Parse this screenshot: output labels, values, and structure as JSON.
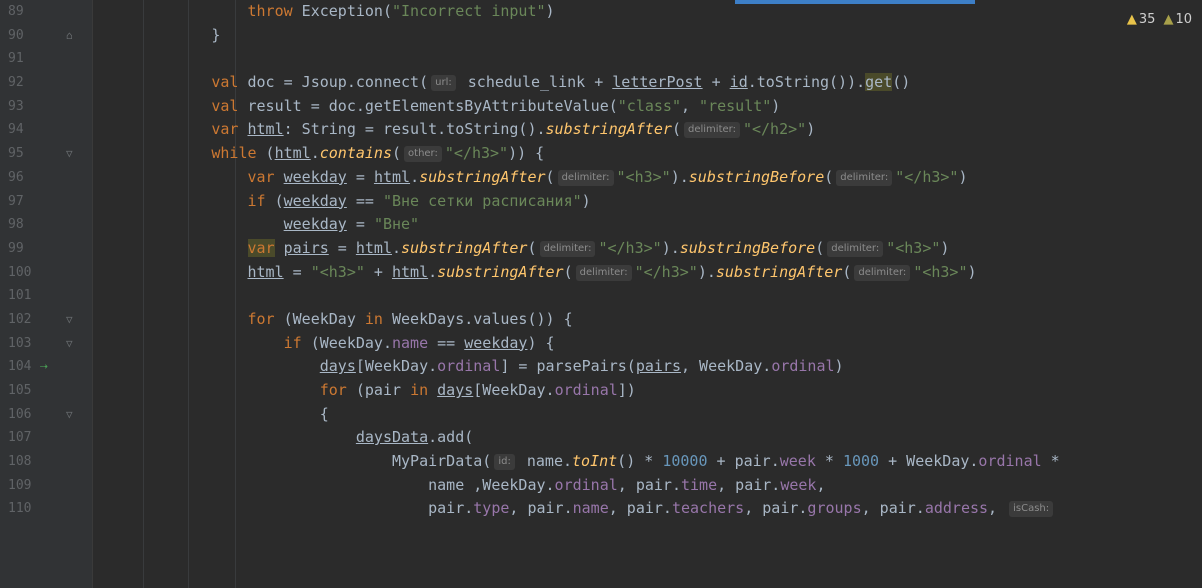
{
  "inspections": {
    "warnings": "35",
    "weak_warnings": "10"
  },
  "line_numbers": [
    "89",
    "90",
    "91",
    "92",
    "93",
    "94",
    "95",
    "96",
    "97",
    "98",
    "99",
    "100",
    "101",
    "102",
    "103",
    "104",
    "105",
    "106",
    "107",
    "108",
    "109",
    "110"
  ],
  "code": {
    "l89": {
      "indent": "                ",
      "kw": "throw",
      "p1": " Exception(",
      "s1": "\"Incorrect input\"",
      "p2": ")"
    },
    "l90": {
      "text": "            }"
    },
    "l92": {
      "indent": "            ",
      "kw": "val",
      "p1": " doc = Jsoup.connect(",
      "h1": "url:",
      "p2": " schedule_link + ",
      "u1": "letterPost",
      "p3": " + ",
      "u2": "id",
      "p4": ".toString()).",
      "m1": "get",
      "p5": "()"
    },
    "l93": {
      "indent": "            ",
      "kw": "val",
      "p1": " result = doc.getElementsByAttributeValue(",
      "s1": "\"class\"",
      "p2": ", ",
      "s2": "\"result\"",
      "p3": ")"
    },
    "l94": {
      "indent": "            ",
      "kw": "var",
      "sp": " ",
      "u1": "html",
      "p1": ": String = result.toString().",
      "f1": "substringAfter",
      "p2": "(",
      "h1": "delimiter:",
      "s1": "\"</h2>\"",
      "p3": ")"
    },
    "l95": {
      "indent": "            ",
      "kw": "while",
      "p1": " (",
      "u1": "html",
      "p2": ".",
      "f1": "contains",
      "p3": "(",
      "h1": "other:",
      "s1": "\"</h3>\"",
      "p4": ")) {"
    },
    "l96": {
      "indent": "                ",
      "kw": "var",
      "sp": " ",
      "u1": "weekday",
      "p1": " = ",
      "u2": "html",
      "p2": ".",
      "f1": "substringAfter",
      "p3": "(",
      "h1": "delimiter:",
      "s1": "\"<h3>\"",
      "p4": ").",
      "f2": "substringBefore",
      "p5": "(",
      "h2": "delimiter:",
      "s2": "\"</h3>\"",
      "p6": ")"
    },
    "l97": {
      "indent": "                ",
      "kw": "if",
      "p1": " (",
      "u1": "weekday",
      "p2": " == ",
      "s1": "\"Вне сетки расписания\"",
      "p3": ")"
    },
    "l98": {
      "indent": "                    ",
      "u1": "weekday",
      "p1": " = ",
      "s1": "\"Вне\""
    },
    "l99": {
      "indent": "                ",
      "kw": "var",
      "sp": " ",
      "u1": "pairs",
      "p1": " = ",
      "u2": "html",
      "p2": ".",
      "f1": "substringAfter",
      "p3": "(",
      "h1": "delimiter:",
      "s1": "\"</h3>\"",
      "p4": ").",
      "f2": "substringBefore",
      "p5": "(",
      "h2": "delimiter:",
      "s2": "\"<h3>\"",
      "p6": ")"
    },
    "l100": {
      "indent": "                ",
      "u1": "html",
      "p1": " = ",
      "s1": "\"<h3>\"",
      "p2": " + ",
      "u2": "html",
      "p3": ".",
      "f1": "substringAfter",
      "p4": "(",
      "h1": "delimiter:",
      "s2": "\"</h3>\"",
      "p5": ").",
      "f2": "substringAfter",
      "p6": "(",
      "h2": "delimiter:",
      "s3": "\"<h3>\"",
      "p7": ")"
    },
    "l102": {
      "indent": "                ",
      "kw": "for",
      "p1": " (WeekDay ",
      "kw2": "in",
      "p2": " WeekDays.values()) {"
    },
    "l103": {
      "indent": "                    ",
      "kw": "if",
      "p1": " (WeekDay.",
      "fd1": "name",
      "p2": " == ",
      "u1": "weekday",
      "p3": ") {"
    },
    "l104": {
      "indent": "                        ",
      "u1": "days",
      "p1": "[WeekDay.",
      "fd1": "ordinal",
      "p2": "] = parsePairs(",
      "u2": "pairs",
      "p3": ", WeekDay.",
      "fd2": "ordinal",
      "p4": ")"
    },
    "l105": {
      "indent": "                        ",
      "kw": "for",
      "p1": " (pair ",
      "kw2": "in",
      "sp": " ",
      "u1": "days",
      "p2": "[WeekDay.",
      "fd1": "ordinal",
      "p3": "])"
    },
    "l106": {
      "text": "                        {"
    },
    "l107": {
      "indent": "                            ",
      "u1": "daysData",
      "p1": ".add("
    },
    "l108": {
      "indent": "                                ",
      "p1": "MyPairData(",
      "h1": "id:",
      "p2": " name.",
      "f1": "toInt",
      "p3": "() * ",
      "n1": "10000",
      "p4": " + pair.",
      "fd1": "week",
      "p5": " * ",
      "n2": "1000",
      "p6": " + WeekDay.",
      "fd2": "ordinal",
      "p7": " *"
    },
    "l109": {
      "indent": "                                    ",
      "p1": "name ,WeekDay.",
      "fd1": "ordinal",
      "p2": ", pair.",
      "fd2": "time",
      "p3": ", pair.",
      "fd3": "week",
      "p4": ","
    },
    "l110": {
      "indent": "                                    ",
      "p1": "pair.",
      "fd1": "type",
      "p2": ", pair.",
      "fd2": "name",
      "p3": ", pair.",
      "fd3": "teachers",
      "p4": ", pair.",
      "fd4": "groups",
      "p5": ", pair.",
      "fd5": "address",
      "p6": ", ",
      "h1": "isCash:"
    }
  }
}
